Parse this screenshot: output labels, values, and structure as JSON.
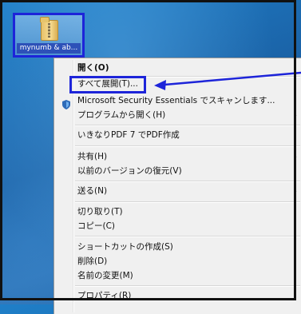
{
  "desktop": {
    "icon_label": "mynumb & ab..."
  },
  "menu": {
    "items": [
      {
        "label": "開く(O)"
      },
      {
        "label": "すべて展開(T)..."
      },
      {
        "label": "Microsoft Security Essentials でスキャンします..."
      },
      {
        "label": "プログラムから開く(H)"
      },
      {
        "label": "いきなりPDF 7 でPDF作成"
      },
      {
        "label": "共有(H)"
      },
      {
        "label": "以前のバージョンの復元(V)"
      },
      {
        "label": "送る(N)"
      },
      {
        "label": "切り取り(T)"
      },
      {
        "label": "コピー(C)"
      },
      {
        "label": "ショートカットの作成(S)"
      },
      {
        "label": "削除(D)"
      },
      {
        "label": "名前の変更(M)"
      },
      {
        "label": "プロパティ(R)"
      }
    ],
    "submenu_arrow": "▸"
  },
  "colors": {
    "annotation": "#1d24d9"
  }
}
